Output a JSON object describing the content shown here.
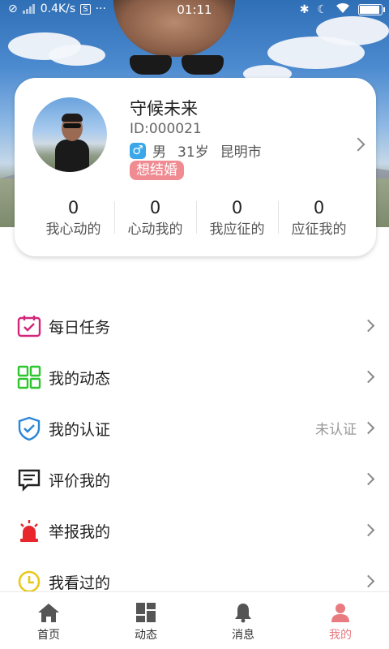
{
  "status_bar": {
    "net_speed": "0.4K/s",
    "dots": "···",
    "time": "01:11"
  },
  "profile": {
    "name": "守候未来",
    "id": "ID:000021",
    "gender_symbol": "♂",
    "gender": "男",
    "age": "31岁",
    "city": "昆明市",
    "tag": "想结婚",
    "stats": [
      {
        "value": "0",
        "label": "我心动的"
      },
      {
        "value": "0",
        "label": "心动我的"
      },
      {
        "value": "0",
        "label": "我应征的"
      },
      {
        "value": "0",
        "label": "应征我的"
      }
    ]
  },
  "menu": [
    {
      "label": "每日任务",
      "icon": "calendar-check-icon",
      "value": ""
    },
    {
      "label": "我的动态",
      "icon": "grid-icon",
      "value": ""
    },
    {
      "label": "我的认证",
      "icon": "shield-check-icon",
      "value": "未认证"
    },
    {
      "label": "评价我的",
      "icon": "comment-icon",
      "value": ""
    },
    {
      "label": "举报我的",
      "icon": "alarm-light-icon",
      "value": ""
    },
    {
      "label": "我看过的",
      "icon": "clock-icon",
      "value": ""
    }
  ],
  "tabbar": [
    {
      "label": "首页",
      "icon": "home-icon"
    },
    {
      "label": "动态",
      "icon": "dashboard-icon"
    },
    {
      "label": "消息",
      "icon": "bell-icon"
    },
    {
      "label": "我的",
      "icon": "user-icon"
    }
  ],
  "colors": {
    "accent_pink": "#e87b80",
    "tag_pink": "#f08b92",
    "gender_blue": "#3aa7e8"
  }
}
